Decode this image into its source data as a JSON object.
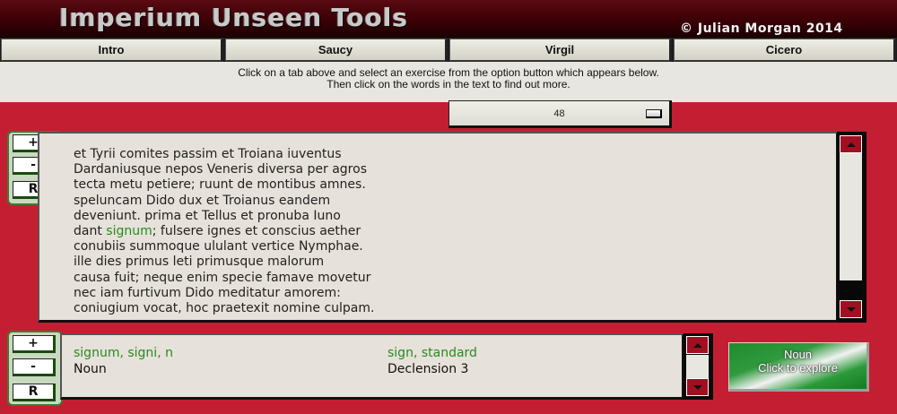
{
  "header": {
    "title": "Imperium Unseen Tools",
    "copyright": "© Julian Morgan 2014"
  },
  "tabs": [
    {
      "label": "Intro"
    },
    {
      "label": "Saucy"
    },
    {
      "label": "Virgil"
    },
    {
      "label": "Cicero"
    }
  ],
  "instructions": {
    "line1": "Click on a tab above and select an exercise from the option button which appears below.",
    "line2": "Then click on the words in the text to find out more."
  },
  "exercise_select": {
    "value": "48"
  },
  "text_zoom": {
    "plus": "+",
    "minus": "-",
    "reset": "R"
  },
  "info_zoom": {
    "plus": "+",
    "minus": "-",
    "reset": "R"
  },
  "passage": {
    "lines": [
      "et Tyrii comites passim et Troiana iuventus",
      "Dardaniusque nepos Veneris diversa per agros",
      "tecta metu petiere; ruunt de montibus amnes.",
      "speluncam Dido dux et Troianus eandem",
      "deveniunt. prima et Tellus et pronuba Iuno",
      "dant ",
      "signum",
      "; fulsere ignes et conscius aether",
      "conubiis summoque ululant vertice Nymphae.",
      "ille dies primus leti primusque malorum",
      "causa fuit; neque enim specie famave movetur",
      "nec iam furtivum Dido meditatur amorem:",
      "coniugium vocat, hoc praetexit nomine culpam."
    ]
  },
  "word_info": {
    "dictionary_form": "signum, signi, n",
    "meaning": "sign, standard",
    "part_of_speech": "Noun",
    "declension": "Declension 3"
  },
  "explore_button": {
    "line1": "Noun",
    "line2": "Click to explore"
  },
  "colors": {
    "background": "#c41e32",
    "highlight": "#2a8a1e",
    "scroll_arrow": "#a01020"
  }
}
